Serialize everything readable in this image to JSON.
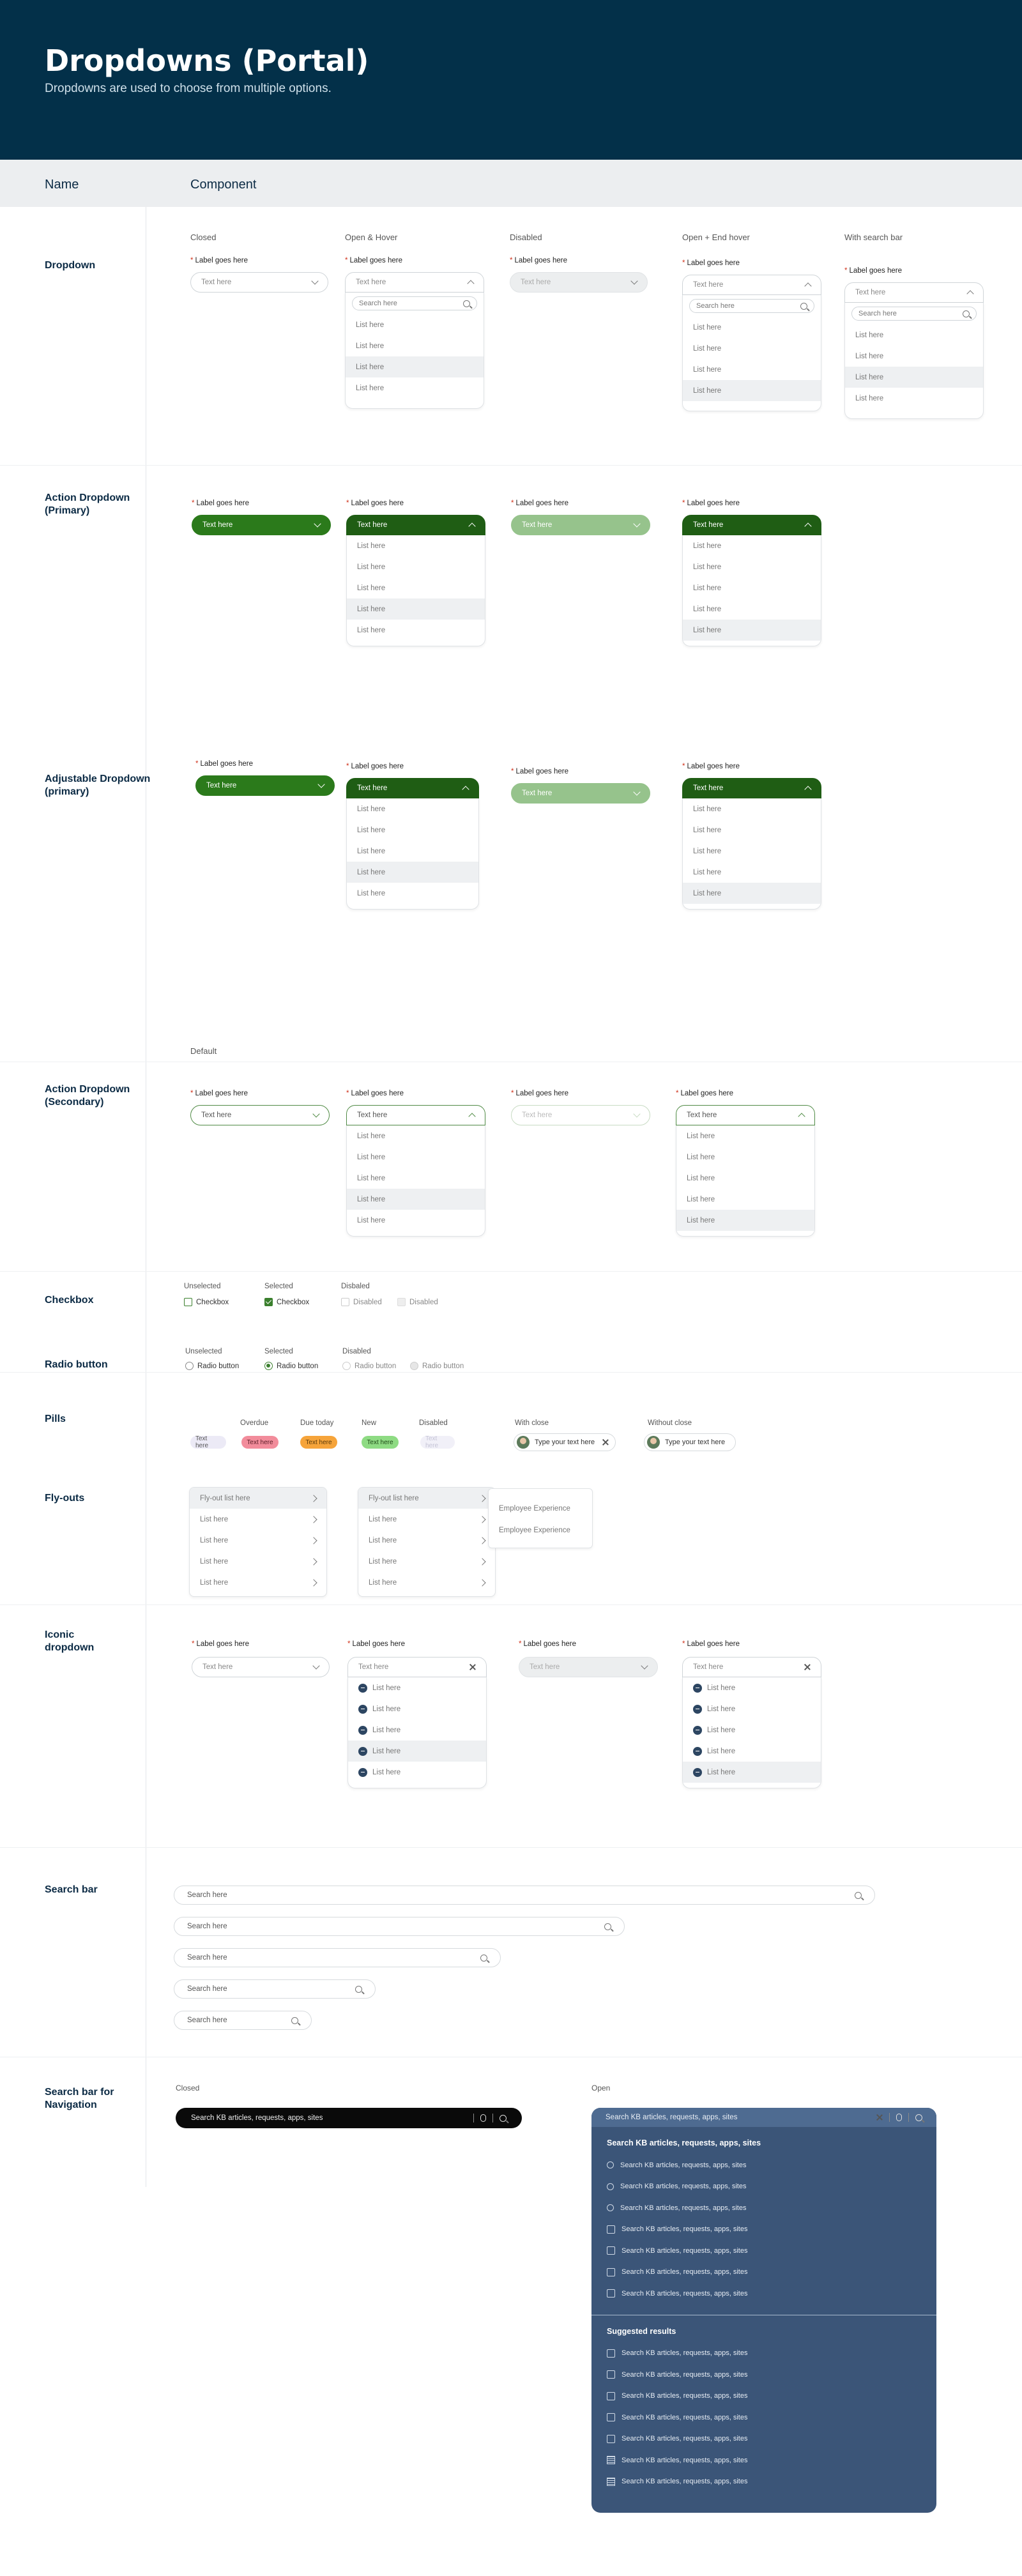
{
  "header": {
    "title": "Dropdowns (Portal)",
    "subtitle": "Dropdowns are used to choose from multiple options."
  },
  "columns": {
    "name": "Name",
    "component": "Component"
  },
  "rows": {
    "dropdown": "Dropdown",
    "action_primary": "Action Dropdown (Primary)",
    "adjustable": "Adjustable Dropdown (primary)",
    "action_secondary": "Action Dropdown (Secondary)",
    "checkbox": "Checkbox",
    "radio": "Radio button",
    "pills": "Pills",
    "flyouts": "Fly-outs",
    "iconic": "Iconic dropdown",
    "searchbar": "Search bar",
    "navsearch": "Search bar for Navigation"
  },
  "states": {
    "closed": "Closed",
    "open_hover": "Open & Hover",
    "disabled": "Disabled",
    "open_end_hover": "Open + End hover",
    "with_search": "With search bar",
    "default": "Default"
  },
  "field": {
    "label": "Label goes here",
    "required": "*",
    "placeholder": "Text here",
    "search": "Search here",
    "list_item": "List here"
  },
  "checkbox": {
    "unselected": "Unselected",
    "selected": "Selected",
    "disabled": "Disbaled",
    "label": "Checkbox",
    "disabled_label": "Disabled"
  },
  "radio": {
    "unselected": "Unselected",
    "selected": "Selected",
    "disabled": "Disabled",
    "label": "Radio button"
  },
  "pills": {
    "overdue": "Overdue",
    "due_today": "Due today",
    "new": "New",
    "disabled": "Disabled",
    "with_close": "With close",
    "without_close": "Without close",
    "text": "Text here",
    "chip_text": "Type your text here"
  },
  "flyouts": {
    "first": "Fly-out list here",
    "item": "List here",
    "sub": [
      "Employee Experience",
      "Employee Experience"
    ]
  },
  "navsearch": {
    "closed": "Closed",
    "open": "Open",
    "placeholder": "Search KB articles, requests, apps, sites",
    "heading": "Search KB articles, requests, apps, sites",
    "suggested": "Suggested results",
    "result": "Search KB articles, requests, apps, sites"
  },
  "colors": {
    "header_bg": "#033049",
    "primary_green": "#2b7a1b",
    "nav_panel": "#3b5578"
  }
}
